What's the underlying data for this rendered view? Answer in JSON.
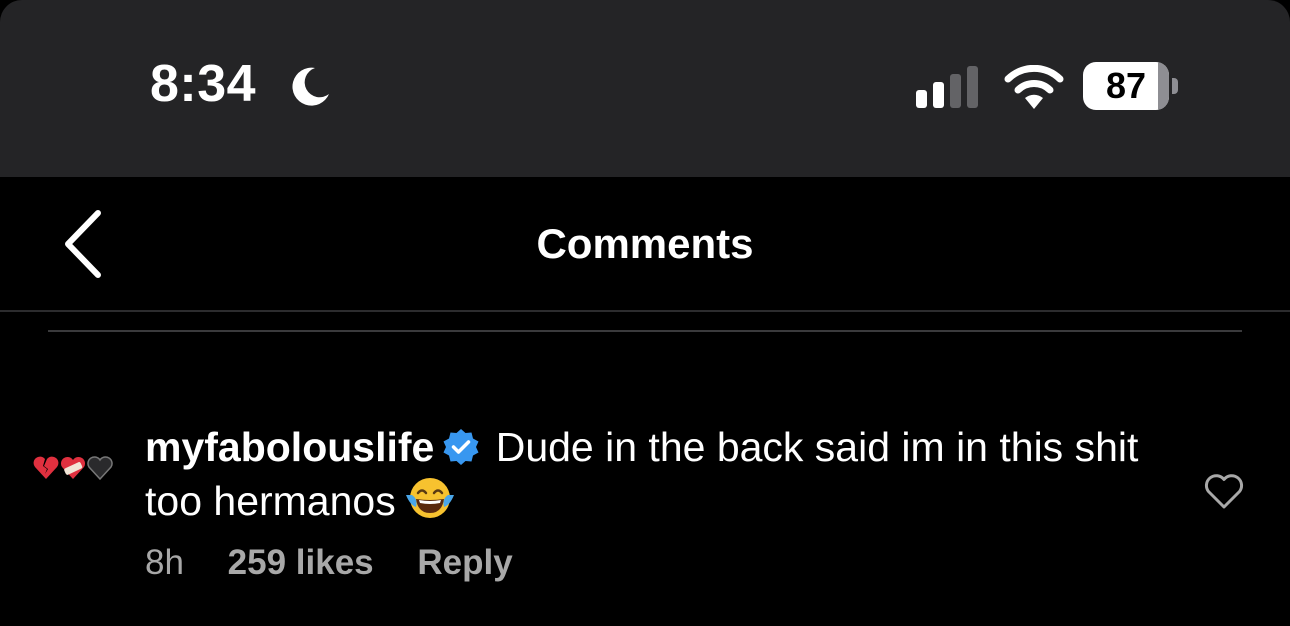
{
  "status_bar": {
    "time": "8:34",
    "battery_percent": "87",
    "battery_level": 0.87,
    "signal_bars_active": 2,
    "signal_bars_total": 4
  },
  "header": {
    "title": "Comments"
  },
  "comment": {
    "username": "myfabolouslife",
    "verified": true,
    "text": "Dude in the back said im in this shit too hermanos",
    "emoji": "face-with-tears-of-joy",
    "time_ago": "8h",
    "likes": "259 likes",
    "reply_label": "Reply"
  },
  "colors": {
    "status_bar_bg": "#242426",
    "background": "#000000",
    "verified_blue": "#3897f0",
    "muted_text": "#a8a8a8"
  }
}
